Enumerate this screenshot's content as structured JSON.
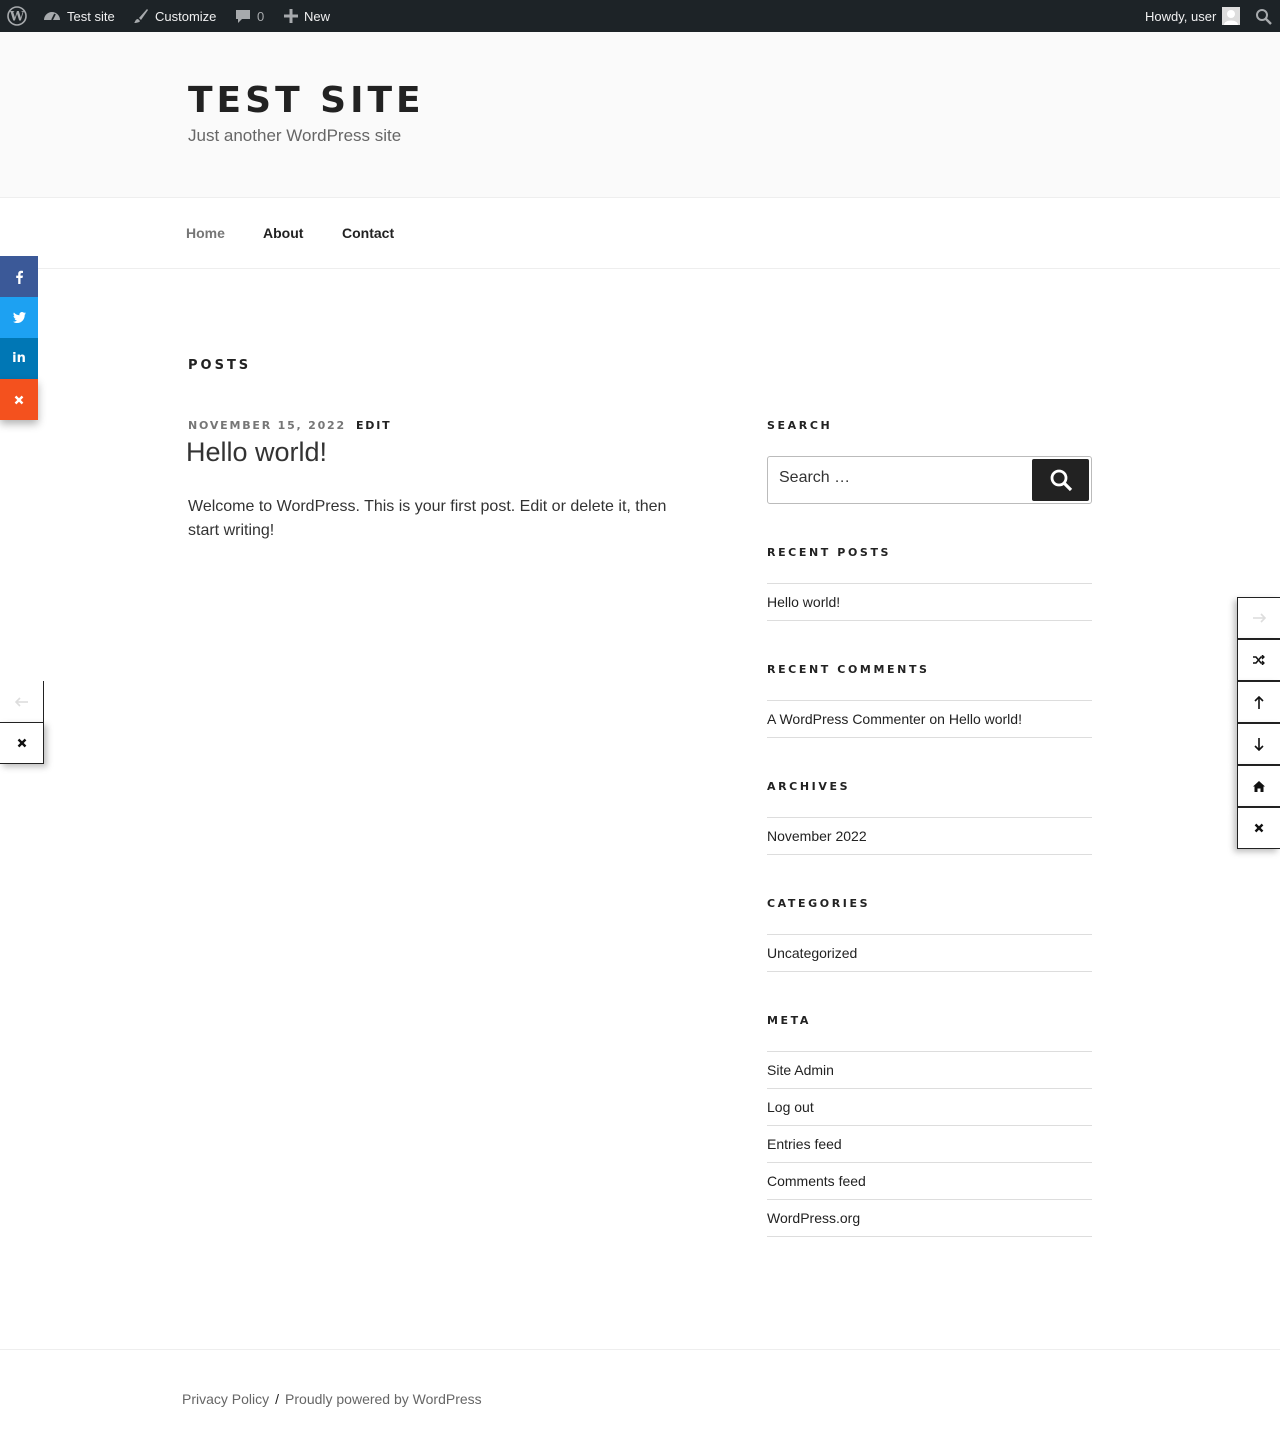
{
  "adminbar": {
    "wp_logo_icon": "wordpress-logo-icon",
    "site_name": "Test site",
    "customize": "Customize",
    "comments_count": "0",
    "new_label": "New",
    "howdy": "Howdy, user"
  },
  "header": {
    "title": "TEST SITE",
    "description": "Just another WordPress site"
  },
  "nav": {
    "items": [
      {
        "label": "Home"
      },
      {
        "label": "About"
      },
      {
        "label": "Contact"
      }
    ]
  },
  "share": {
    "colors": {
      "facebook": "#3b5998",
      "twitter": "#1da1f2",
      "linkedin": "#0077b5",
      "close": "#f4511e"
    }
  },
  "main": {
    "page_title": "POSTS",
    "post": {
      "date": "NOVEMBER 15, 2022",
      "edit": "EDIT",
      "title": "Hello world!",
      "excerpt": "Welcome to WordPress. This is your first post. Edit or delete it, then start writing!"
    }
  },
  "sidebar": {
    "search": {
      "title": "SEARCH",
      "placeholder": "Search …"
    },
    "recent_posts": {
      "title": "RECENT POSTS",
      "items": [
        "Hello world!"
      ]
    },
    "recent_comments": {
      "title": "RECENT COMMENTS",
      "author": "A WordPress Commenter",
      "on": "on",
      "post": "Hello world!"
    },
    "archives": {
      "title": "ARCHIVES",
      "items": [
        "November 2022"
      ]
    },
    "categories": {
      "title": "CATEGORIES",
      "items": [
        "Uncategorized"
      ]
    },
    "meta": {
      "title": "META",
      "items": [
        "Site Admin",
        "Log out",
        "Entries feed",
        "Comments feed",
        "WordPress.org"
      ]
    }
  },
  "footer": {
    "privacy": "Privacy Policy",
    "separator": "/",
    "powered": "Proudly powered by WordPress"
  }
}
